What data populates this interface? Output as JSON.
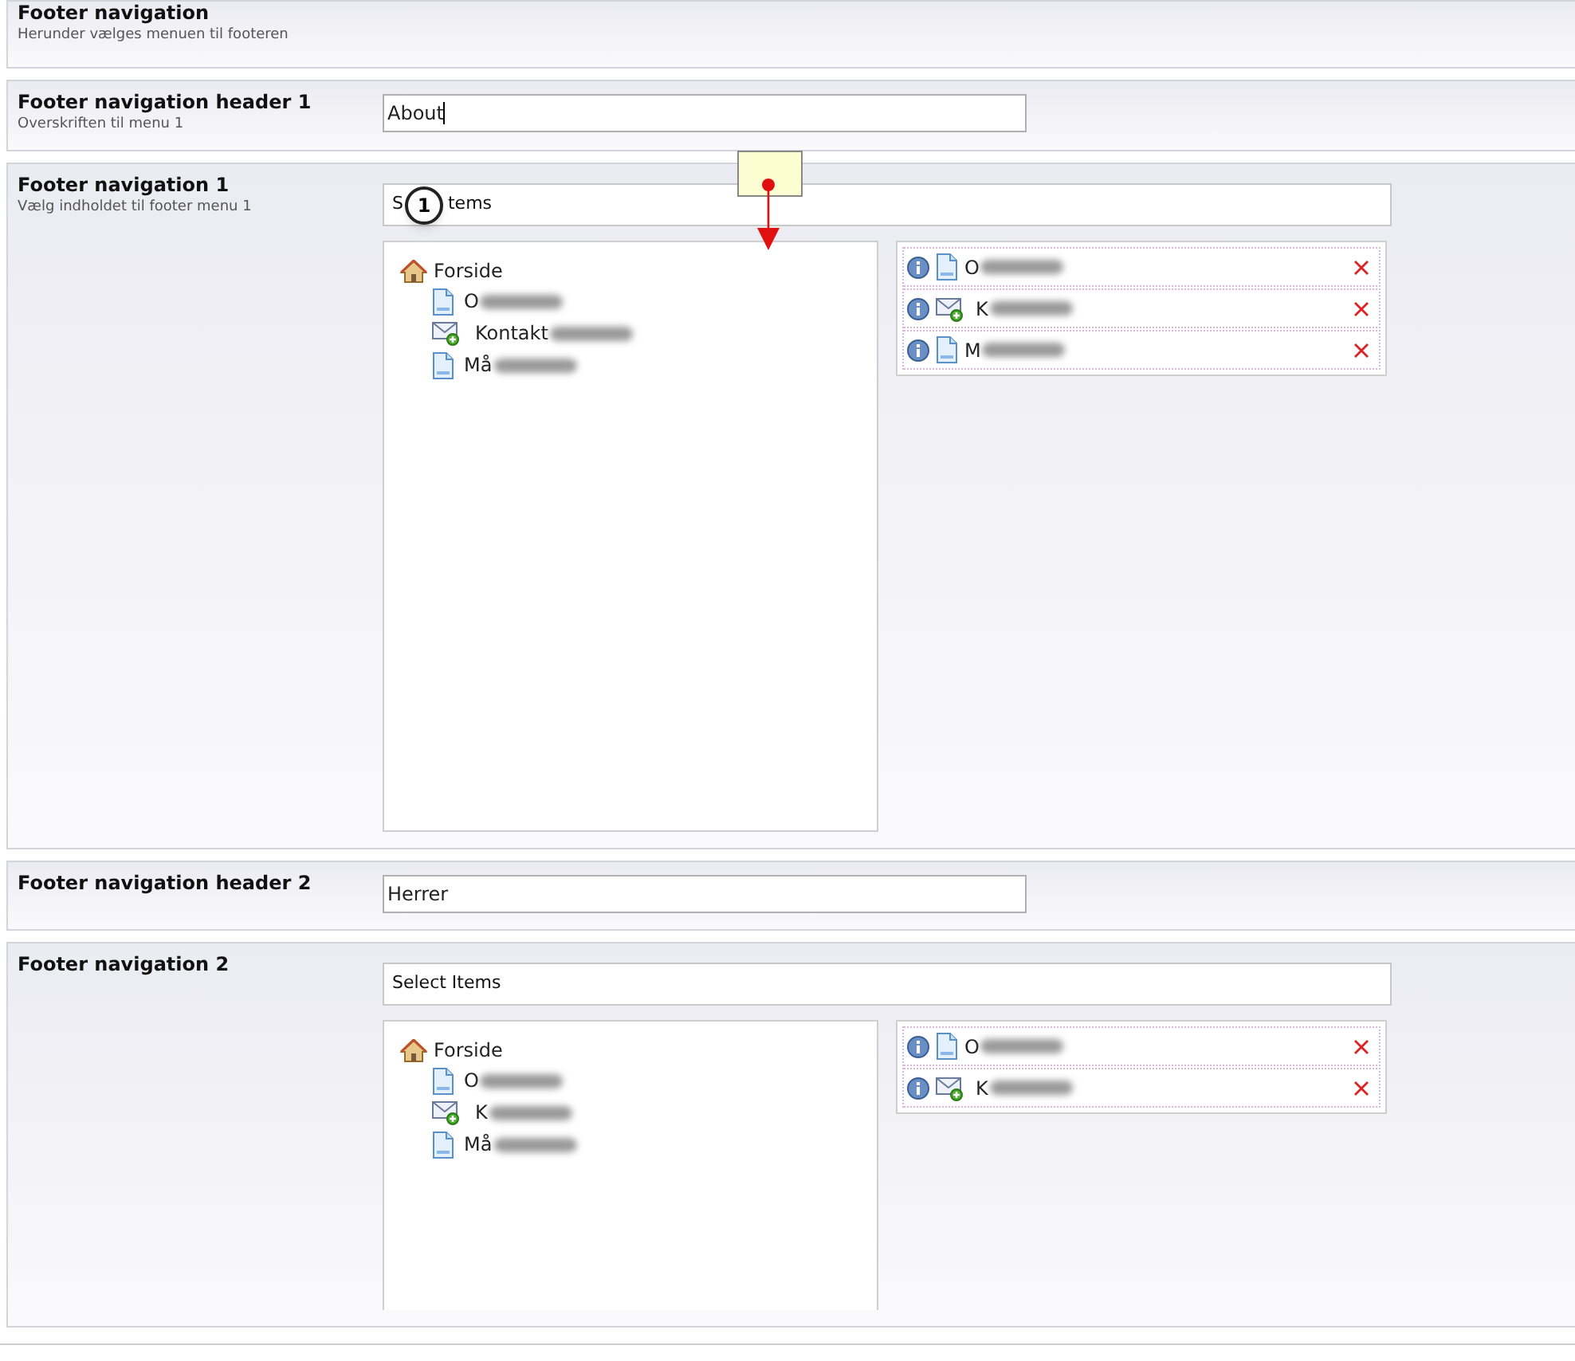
{
  "sections": [
    {
      "kind": "heading",
      "title": "Footer navigation",
      "description": "Herunder vælges menuen til footeren"
    },
    {
      "kind": "text",
      "title": "Footer navigation header 1",
      "description": "Overskriften til menu 1",
      "value": "About",
      "caret": true
    },
    {
      "kind": "picker",
      "title": "Footer navigation 1",
      "description": "Vælg indholdet til footer menu 1",
      "select_label": [
        "S",
        "tems"
      ],
      "tree": {
        "label": "Forside",
        "kind": "home",
        "children": [
          {
            "label": "O",
            "kind": "page",
            "redacted": true
          },
          {
            "label": "Kontakt",
            "kind": "mail",
            "redacted": true
          },
          {
            "label": "Må",
            "kind": "page",
            "redacted": true
          }
        ]
      },
      "selected_items": [
        {
          "label": "O",
          "kind": "page",
          "redacted": true
        },
        {
          "label": "K",
          "kind": "mail",
          "redacted": true
        },
        {
          "label": "M",
          "kind": "page",
          "redacted": true
        }
      ],
      "annotation": {
        "number": "1"
      }
    },
    {
      "kind": "text",
      "title": "Footer navigation header 2",
      "value": "Herrer",
      "caret": false
    },
    {
      "kind": "picker",
      "title": "Footer navigation 2",
      "select_label": [
        "Select Items"
      ],
      "tree": {
        "label": "Forside",
        "kind": "home",
        "children": [
          {
            "label": "O",
            "kind": "page",
            "redacted": true
          },
          {
            "label": "K",
            "kind": "mail",
            "redacted": true
          },
          {
            "label": "Må",
            "kind": "page",
            "redacted": true
          }
        ]
      },
      "selected_items": [
        {
          "label": "O",
          "kind": "page",
          "redacted": true
        },
        {
          "label": "K",
          "kind": "mail",
          "redacted": true
        }
      ]
    }
  ]
}
